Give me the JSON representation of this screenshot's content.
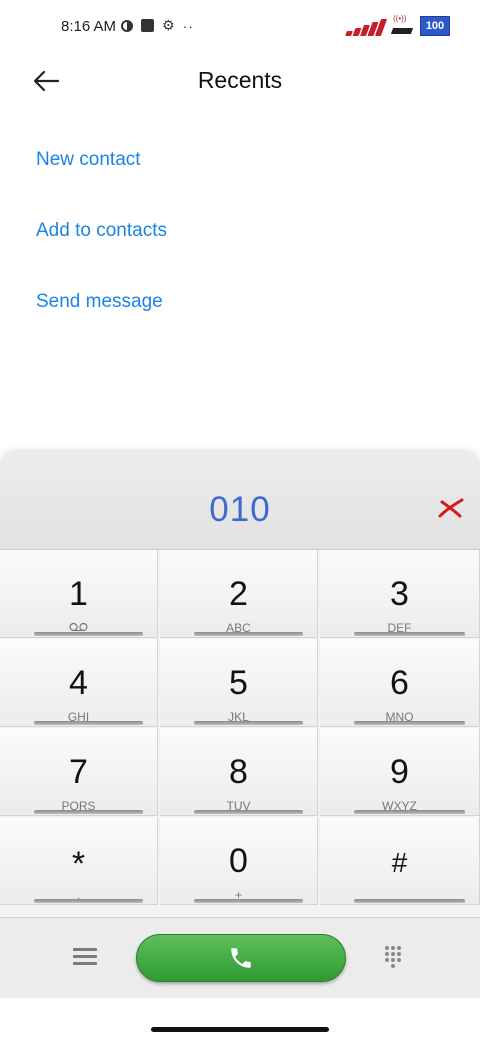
{
  "status_bar": {
    "time": "8:16 AM",
    "dots": "··",
    "battery": "100"
  },
  "header": {
    "title": "Recents"
  },
  "actions": [
    {
      "label": "New contact"
    },
    {
      "label": "Add to contacts"
    },
    {
      "label": "Send message"
    }
  ],
  "dialer": {
    "number": "010",
    "keys": [
      {
        "digit": "1",
        "sub": ""
      },
      {
        "digit": "2",
        "sub": "ABC"
      },
      {
        "digit": "3",
        "sub": "DEF"
      },
      {
        "digit": "4",
        "sub": "GHI"
      },
      {
        "digit": "5",
        "sub": "JKL"
      },
      {
        "digit": "6",
        "sub": "MNO"
      },
      {
        "digit": "7",
        "sub": "PQRS"
      },
      {
        "digit": "8",
        "sub": "TUV"
      },
      {
        "digit": "9",
        "sub": "WXYZ"
      },
      {
        "digit": "*",
        "sub": ","
      },
      {
        "digit": "0",
        "sub": "+"
      },
      {
        "digit": "#",
        "sub": ""
      }
    ]
  },
  "colors": {
    "link": "#1a84e4",
    "number": "#3c6bd0",
    "call": "#2f9a33"
  },
  "icons": {
    "back": "arrow-left-icon",
    "delete": "delete-x-icon",
    "voicemail": "voicemail-icon",
    "menu": "menu-icon",
    "call": "phone-icon",
    "keypad": "dialpad-icon"
  }
}
